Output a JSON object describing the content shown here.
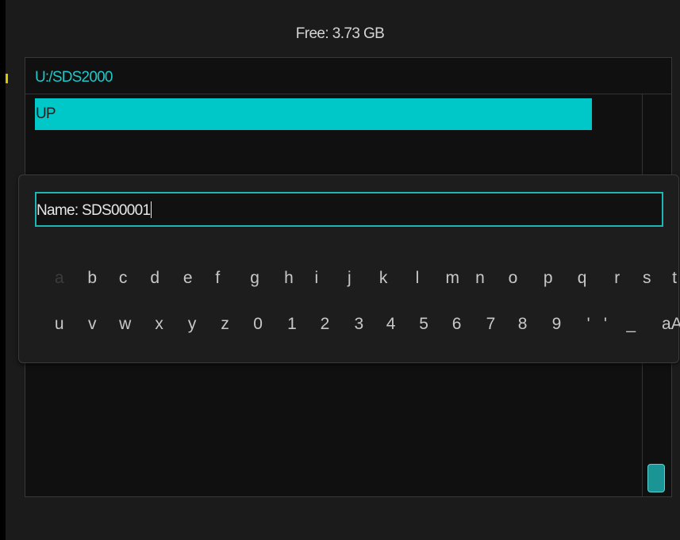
{
  "storage": {
    "free_label": "Free: 3.73 GB"
  },
  "browser": {
    "path": "U:/SDS2000",
    "items": [
      {
        "label": "UP"
      }
    ]
  },
  "keyboard": {
    "name_prompt": "Name: SDS00001",
    "rows": [
      [
        "a",
        "b",
        "c",
        "d",
        "e",
        "f",
        "g",
        "h",
        "i",
        "j",
        "k",
        "l",
        "m",
        "n",
        "o",
        "p",
        "q",
        "r",
        "s",
        "t"
      ],
      [
        "u",
        "v",
        "w",
        "x",
        "y",
        "z",
        "0",
        "1",
        "2",
        "3",
        "4",
        "5",
        "6",
        "7",
        "8",
        "9",
        "'",
        "'",
        "_",
        "aA"
      ]
    ],
    "selected_key": "a"
  },
  "colors": {
    "accent": "#00c8c8",
    "path_text": "#1fc8c8",
    "background": "#1b1b1b"
  }
}
